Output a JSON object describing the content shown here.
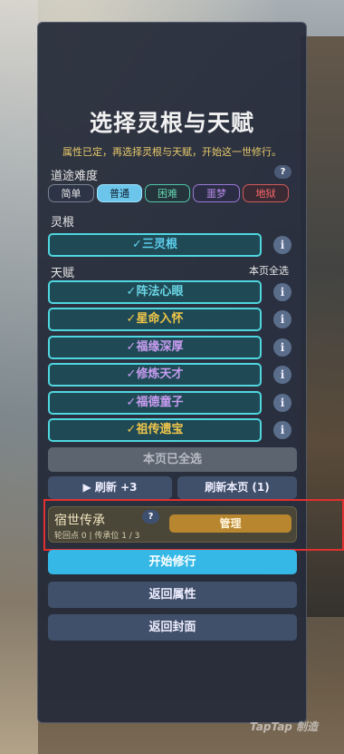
{
  "title": "选择灵根与天赋",
  "subtitle": "属性已定，再选择灵根与天赋，开始这一世修行。",
  "difficulty": {
    "label": "道途难度",
    "help": "?",
    "options": [
      {
        "label": "简单",
        "color": "#e6e6e6",
        "selected": false
      },
      {
        "label": "普通",
        "color": "#102030",
        "selected": true
      },
      {
        "label": "困难",
        "color": "#63d6b0",
        "selected": false
      },
      {
        "label": "噩梦",
        "color": "#b58ae6",
        "selected": false
      },
      {
        "label": "地狱",
        "color": "#ff6a6a",
        "selected": false
      }
    ]
  },
  "root": {
    "label": "灵根",
    "item": {
      "text": "✓三灵根",
      "color": "#5fd0f0"
    }
  },
  "talents": {
    "label": "天赋",
    "select_all_page": "本页全选",
    "items": [
      {
        "text": "✓阵法心眼",
        "color": "#6ad7e6"
      },
      {
        "text": "✓星命入怀",
        "color": "#f0c64a"
      },
      {
        "text": "✓福缘深厚",
        "color": "#c79cf0"
      },
      {
        "text": "✓修炼天才",
        "color": "#c79cf0"
      },
      {
        "text": "✓福德童子",
        "color": "#c79cf0"
      },
      {
        "text": "✓祖传遗宝",
        "color": "#f0c64a"
      }
    ]
  },
  "info_icon": "i",
  "all_selected_button": "本页已全选",
  "refresh_button": "▶ 刷新 +3",
  "refresh_page_button": "刷新本页 (1)",
  "legacy": {
    "title": "宿世传承",
    "help": "?",
    "stats": "轮回点 0 | 传承位 1 / 3",
    "manage_button": "管理"
  },
  "start_button": "开始修行",
  "back_attributes_button": "返回属性",
  "back_cover_button": "返回封面",
  "watermark": "TapTap 制造"
}
